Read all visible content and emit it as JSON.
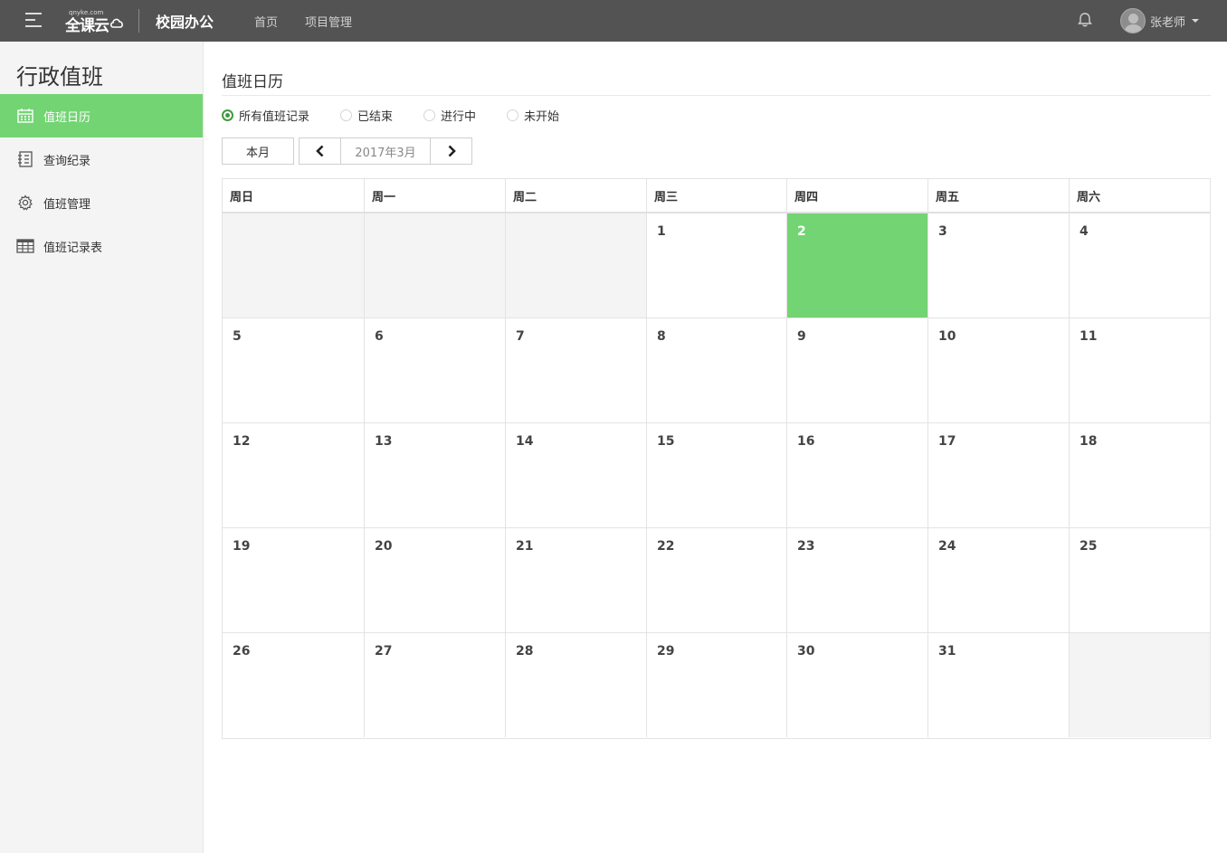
{
  "header": {
    "logo_text": "全课云",
    "logo_sub": "qnyke.com",
    "app_title": "校园办公",
    "nav": [
      {
        "label": "首页"
      },
      {
        "label": "项目管理"
      }
    ],
    "user_name": "张老师"
  },
  "sidebar": {
    "title": "行政值班",
    "items": [
      {
        "label": "值班日历",
        "icon": "calendar-icon",
        "active": true
      },
      {
        "label": "查询纪录",
        "icon": "list-icon",
        "active": false
      },
      {
        "label": "值班管理",
        "icon": "gear-icon",
        "active": false
      },
      {
        "label": "值班记录表",
        "icon": "table-icon",
        "active": false
      }
    ]
  },
  "main": {
    "title": "值班日历",
    "filters": [
      {
        "label": "所有值班记录",
        "checked": true
      },
      {
        "label": "已结束",
        "checked": false
      },
      {
        "label": "进行中",
        "checked": false
      },
      {
        "label": "未开始",
        "checked": false
      }
    ],
    "this_month_label": "本月",
    "month_label": "2017年3月",
    "weekdays": [
      "周日",
      "周一",
      "周二",
      "周三",
      "周四",
      "周五",
      "周六"
    ],
    "weeks": [
      [
        "",
        "",
        "",
        "1",
        "2",
        "3",
        "4"
      ],
      [
        "5",
        "6",
        "7",
        "8",
        "9",
        "10",
        "11"
      ],
      [
        "12",
        "13",
        "14",
        "15",
        "16",
        "17",
        "18"
      ],
      [
        "19",
        "20",
        "21",
        "22",
        "23",
        "24",
        "25"
      ],
      [
        "26",
        "27",
        "28",
        "29",
        "30",
        "31",
        ""
      ]
    ],
    "today": "2"
  },
  "colors": {
    "topbar": "#535353",
    "accent": "#73d473",
    "radio_checked": "#3f9b3f",
    "sidebar_bg": "#f4f4f4"
  }
}
